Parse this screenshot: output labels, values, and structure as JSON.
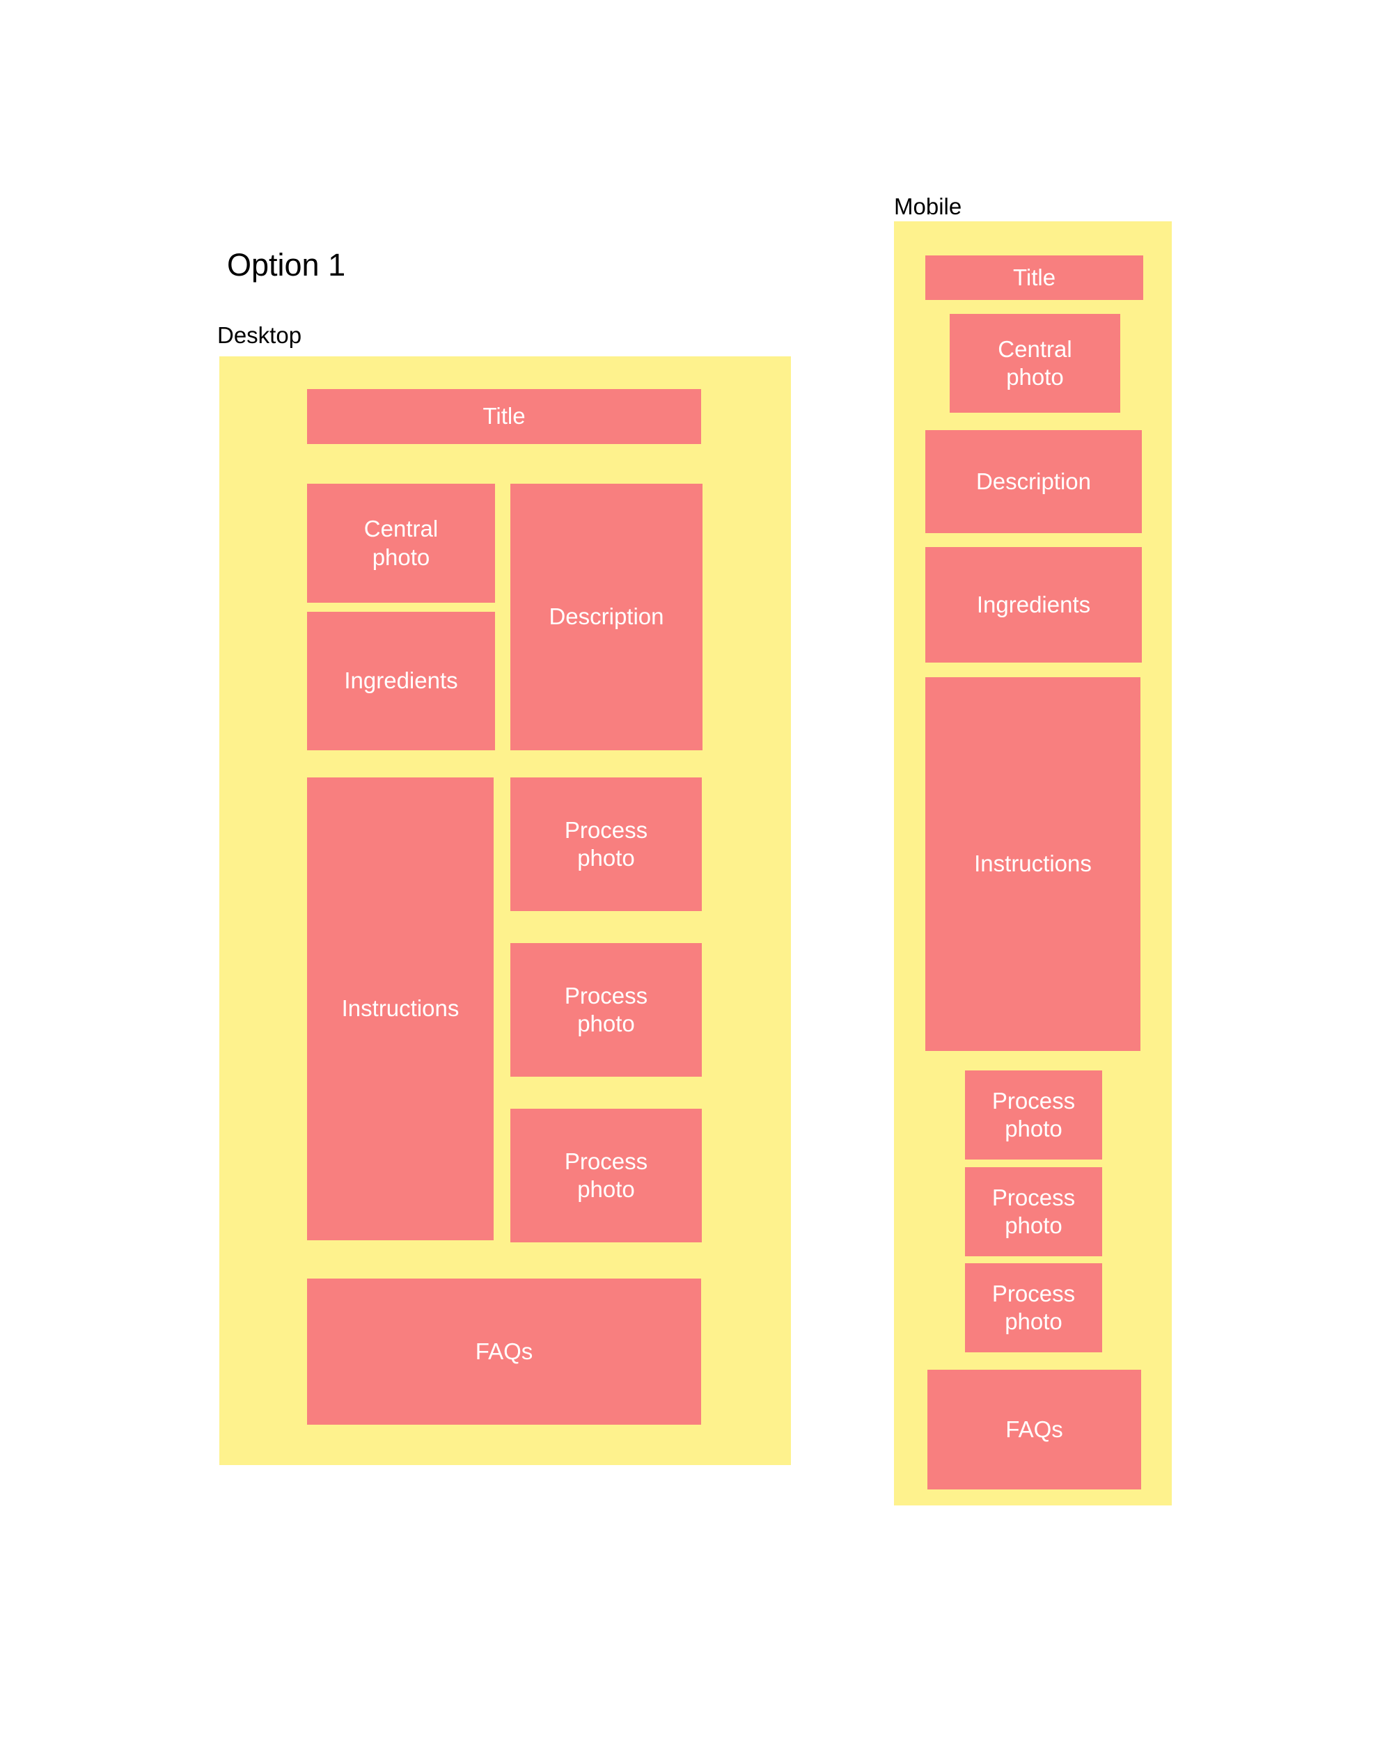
{
  "option_title": "Option 1",
  "desktop": {
    "label": "Desktop",
    "blocks": {
      "title": "Title",
      "central_photo": [
        "Central",
        "photo"
      ],
      "ingredients": "Ingredients",
      "description": "Description",
      "instructions": "Instructions",
      "process_photo_1": [
        "Process",
        "photo"
      ],
      "process_photo_2": [
        "Process",
        "photo"
      ],
      "process_photo_3": [
        "Process",
        "photo"
      ],
      "faqs": "FAQs"
    }
  },
  "mobile": {
    "label": "Mobile",
    "blocks": {
      "title": "Title",
      "central_photo": [
        "Central",
        "photo"
      ],
      "description": "Description",
      "ingredients": "Ingredients",
      "instructions": "Instructions",
      "process_photo_1": [
        "Process",
        "photo"
      ],
      "process_photo_2": [
        "Process",
        "photo"
      ],
      "process_photo_3": [
        "Process",
        "photo"
      ],
      "faqs": "FAQs"
    }
  },
  "colors": {
    "panel": "#FEF28D",
    "block": "#F87F7F",
    "block_text": "#FFFFFF"
  }
}
